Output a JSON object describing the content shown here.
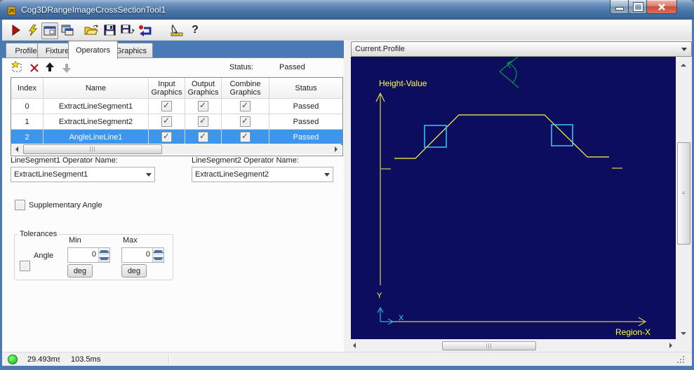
{
  "window": {
    "title": "Cog3DRangeImageCrossSectionTool1"
  },
  "icons": {
    "help_glyph": "?"
  },
  "toolbar": {
    "items": [
      "run",
      "live-run",
      "show-tool-display",
      "float-tool-display",
      "open",
      "save",
      "save-as",
      "reset",
      "electrode",
      "help"
    ]
  },
  "tabs": {
    "items": [
      "Profile",
      "Fixture",
      "Operators",
      "Graphics"
    ],
    "selected": "Operators"
  },
  "operators_panel": {
    "status_label": "Status:",
    "status_value": "Passed",
    "table": {
      "columns": [
        "Index",
        "Name",
        "Input Graphics",
        "Output Graphics",
        "Combine Graphics",
        "Status"
      ],
      "rows": [
        {
          "index": "0",
          "name": "ExtractLineSegment1",
          "input_graphics": true,
          "output_graphics": true,
          "combine_graphics": true,
          "status": "Passed",
          "selected": false
        },
        {
          "index": "1",
          "name": "ExtractLineSegment2",
          "input_graphics": true,
          "output_graphics": true,
          "combine_graphics": true,
          "status": "Passed",
          "selected": false
        },
        {
          "index": "2",
          "name": "AngleLineLine1",
          "input_graphics": true,
          "output_graphics": true,
          "combine_graphics": true,
          "status": "Passed",
          "selected": true
        }
      ]
    },
    "linesegment1_label": "LineSegment1 Operator Name:",
    "linesegment1_value": "ExtractLineSegment1",
    "linesegment2_label": "LineSegment2 Operator Name:",
    "linesegment2_value": "ExtractLineSegment2",
    "supplementary_label": "Supplementary Angle",
    "tolerances": {
      "title": "Tolerances",
      "angle_label": "Angle",
      "min_label": "Min",
      "max_label": "Max",
      "min_value": "0",
      "max_value": "0",
      "unit_label": "deg"
    }
  },
  "display_panel": {
    "selector_value": "Current.Profile",
    "graph": {
      "background_color": "#0d0d5e",
      "axis_color": "#ffff40",
      "feature_color": "#33ccff",
      "angle_color": "#00b34d",
      "y_axis_label": "Height-Value",
      "x_axis_label": "Region-X",
      "x_marker": "X",
      "y_marker": "Y",
      "profile_points": [
        [
          62,
          145
        ],
        [
          92,
          145
        ],
        [
          154,
          83
        ],
        [
          276,
          83
        ],
        [
          337,
          143
        ],
        [
          368,
          143
        ]
      ]
    }
  },
  "status_bar": {
    "time1": "29.493ms",
    "time2": "103.5ms"
  }
}
